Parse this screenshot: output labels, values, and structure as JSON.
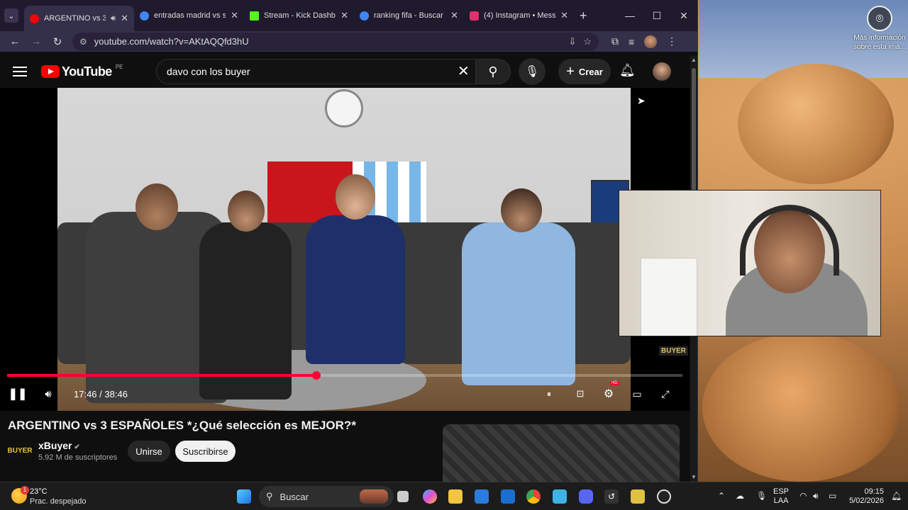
{
  "browser": {
    "tabs": [
      {
        "title": "ARGENTINO vs 3",
        "favicon_color": "#ff0000",
        "active": true
      },
      {
        "title": "entradas madrid vs se",
        "favicon_color": "#4285f4",
        "active": false
      },
      {
        "title": "Stream - Kick Dashbo",
        "favicon_color": "#53fc18",
        "active": false
      },
      {
        "title": "ranking fifa - Buscar c",
        "favicon_color": "#4285f4",
        "active": false
      },
      {
        "title": "(4) Instagram • Mess",
        "favicon_color": "#e1306c",
        "active": false
      }
    ],
    "url": "youtube.com/watch?v=AKtAQQfd3hU"
  },
  "youtube": {
    "logo_text": "YouTube",
    "country_code": "PE",
    "search_query": "davo con los buyer",
    "create_label": "Crear"
  },
  "player": {
    "current_time": "17:46",
    "duration": "38:46",
    "progress_fraction": 0.458,
    "progress_color": "#ff0033",
    "watermark": "BUYER"
  },
  "video": {
    "title": "ARGENTINO vs 3 ESPAÑOLES *¿Qué selección es MEJOR?*",
    "channel_logo": "BUYER",
    "channel_name": "xBuyer",
    "subscribers": "5.92 M de suscriptores",
    "join_label": "Unirse",
    "subscribe_label": "Suscribirse"
  },
  "desktop": {
    "info_text": "Más información sobre esta ima..."
  },
  "taskbar": {
    "weather_badge": "1",
    "temperature": "23°C",
    "weather_desc": "Prac. despejado",
    "search_label": "Buscar",
    "lang_top": "ESP",
    "lang_bottom": "LAA",
    "time": "09:15",
    "date": "5/02/2026"
  }
}
